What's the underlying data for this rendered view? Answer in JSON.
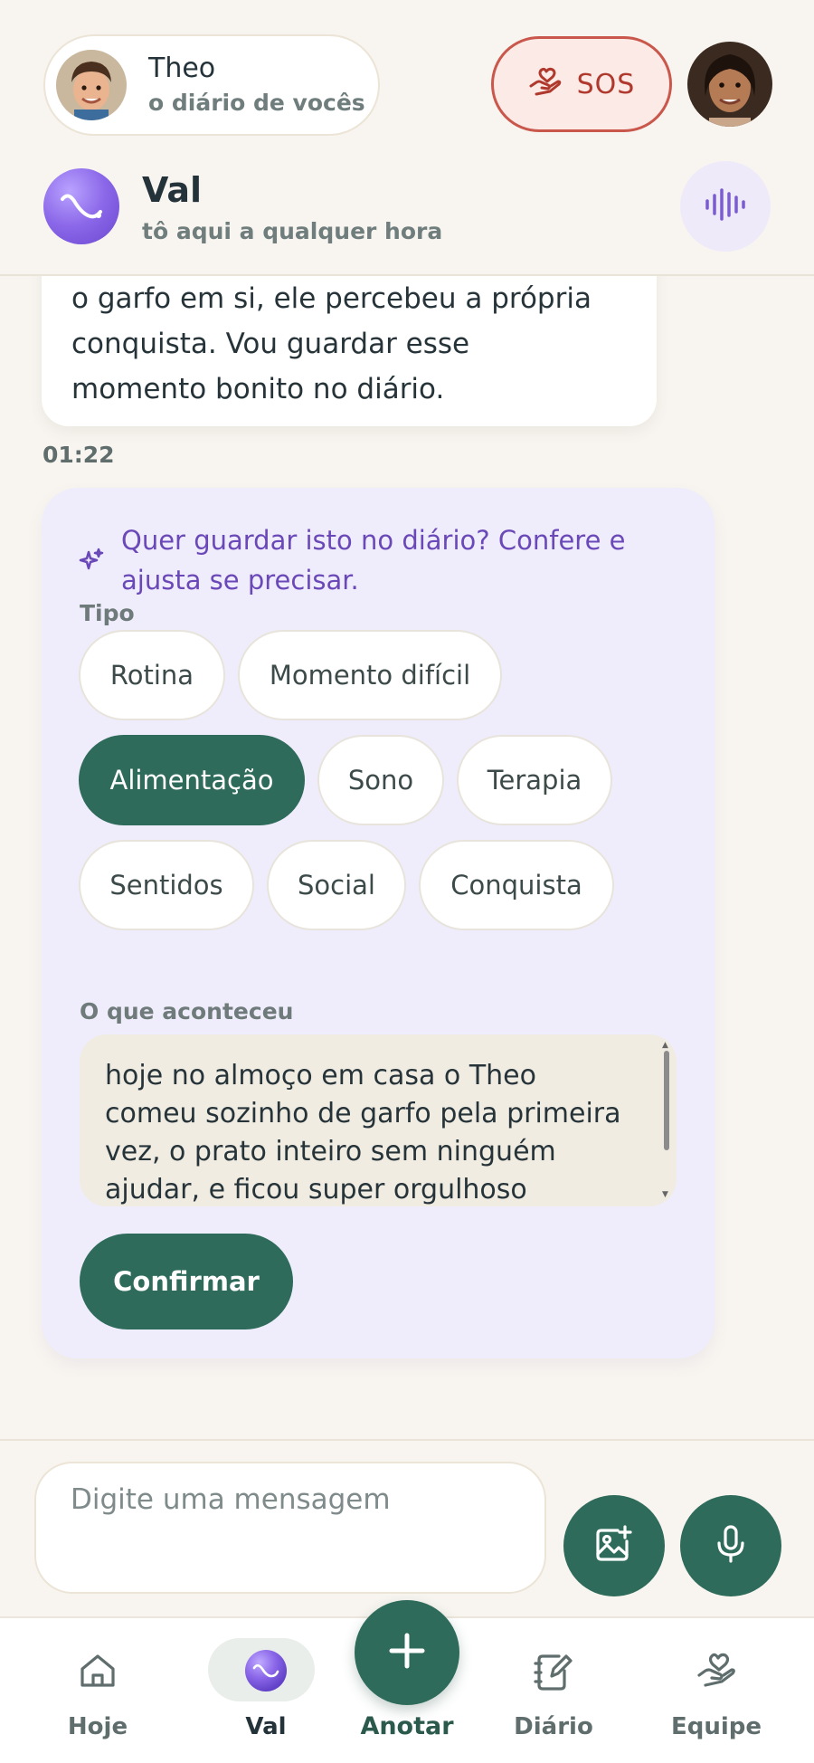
{
  "header": {
    "child_name": "Theo",
    "child_subtitle": "o diário de vocês",
    "sos_label": "SOS"
  },
  "assistant": {
    "name": "Val",
    "subtitle": "tô aqui a qualquer hora"
  },
  "chat": {
    "message_lines": [
      "o garfo em si, ele percebeu a própria",
      "conquista. Vou guardar esse",
      "momento bonito no diário."
    ],
    "message_time": "01:22"
  },
  "save_card": {
    "title": "Quer guardar isto no diário? Confere e ajusta se precisar.",
    "type_label": "Tipo",
    "types": [
      "Rotina",
      "Momento difícil",
      "Alimentação",
      "Sono",
      "Terapia",
      "Sentidos",
      "Social",
      "Conquista"
    ],
    "selected_type": "Alimentação",
    "what_label": "O que aconteceu",
    "what_value": "hoje no almoço em casa o Theo comeu sozinho de garfo pela primeira vez, o prato inteiro sem ninguém ajudar, e ficou super orgulhoso",
    "confirm_label": "Confirmar"
  },
  "composer": {
    "placeholder": "Digite uma mensagem"
  },
  "nav": {
    "items": [
      "Hoje",
      "Val",
      "Anotar",
      "Diário",
      "Equipe"
    ],
    "active": "Val"
  },
  "colors": {
    "primary": "#2e6b5a",
    "assistant_accent": "#6a48b8",
    "card_bg": "#efedfb",
    "sos": "#c9574c",
    "background": "#f8f5f0"
  }
}
